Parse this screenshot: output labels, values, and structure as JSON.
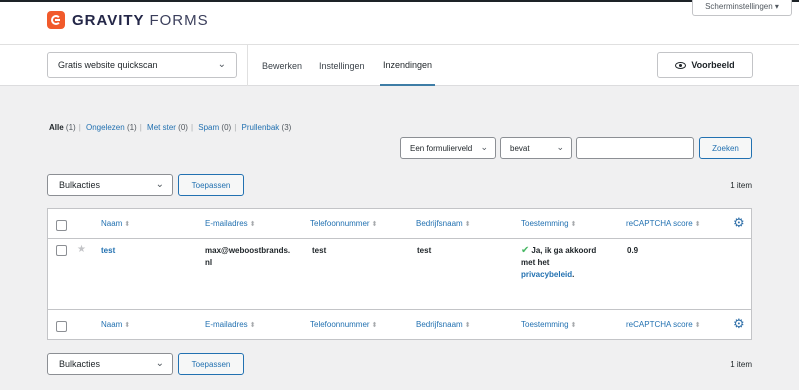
{
  "brand": {
    "name_bold": "GRAVITY",
    "name_thin": "FORMS"
  },
  "screen_options": "Scherminstellingen ▾",
  "form_selector": {
    "value": "Gratis website quickscan"
  },
  "tabs": [
    {
      "label": "Bewerken",
      "active": false
    },
    {
      "label": "Instellingen",
      "active": false
    },
    {
      "label": "Inzendingen",
      "active": true
    }
  ],
  "preview_button": "Voorbeeld",
  "filters": {
    "all": "Alle",
    "all_count": "(1)",
    "unread": "Ongelezen",
    "unread_count": "(1)",
    "starred": "Met ster",
    "starred_count": "(0)",
    "spam": "Spam",
    "spam_count": "(0)",
    "trash": "Prullenbak",
    "trash_count": "(3)"
  },
  "search": {
    "field": "Een formulierveld",
    "operator": "bevat",
    "value": "",
    "button": "Zoeken"
  },
  "bulk": {
    "label": "Bulkacties",
    "apply": "Toepassen",
    "count": "1 item"
  },
  "columns": [
    "Naam",
    "E-mailadres",
    "Telefoonnummer",
    "Bedrijfsnaam",
    "Toestemming",
    "reCAPTCHA score"
  ],
  "entries": [
    {
      "name": "test",
      "email_line1": "max@weboostbrands.",
      "email_line2": "nl",
      "phone": "test",
      "company": "test",
      "consent_line1": "Ja, ik ga akkoord",
      "consent_line2": "met het",
      "consent_link": "privacybeleid",
      "consent_end": ".",
      "recaptcha": "0.9"
    }
  ],
  "icons": {
    "sort": "sort-arrows-icon",
    "gear": "gear-icon",
    "star": "star-icon",
    "check": "checkmark-icon",
    "eye": "eye-icon"
  },
  "colors": {
    "brand": "#f15a2b",
    "link": "#2271b1",
    "check": "#4ab866"
  }
}
